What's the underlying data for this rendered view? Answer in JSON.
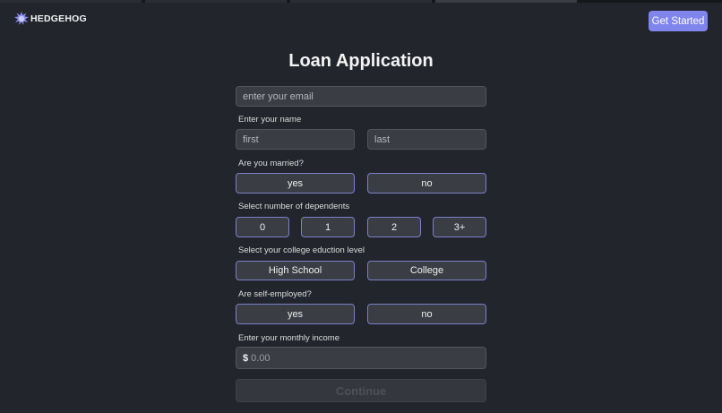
{
  "header": {
    "brand": "HEDGEHOG",
    "cta_label": "Get Started",
    "accent_color": "#7f85ec"
  },
  "form": {
    "title": "Loan Application",
    "email_placeholder": "enter your email",
    "name": {
      "label": "Enter your name",
      "first_placeholder": "first",
      "last_placeholder": "last"
    },
    "married": {
      "label": "Are you married?",
      "options": [
        "yes",
        "no"
      ]
    },
    "dependents": {
      "label": "Select number of dependents",
      "options": [
        "0",
        "1",
        "2",
        "3+"
      ]
    },
    "education": {
      "label": "Select your college eduction level",
      "options": [
        "High School",
        "College"
      ]
    },
    "self_employed": {
      "label": "Are self-employed?",
      "options": [
        "yes",
        "no"
      ]
    },
    "income": {
      "label": "Enter your monthly income",
      "currency_symbol": "$",
      "placeholder": "0.00"
    },
    "continue_label": "Continue"
  },
  "icons": {
    "logo": "hedgehog-logo-icon"
  }
}
